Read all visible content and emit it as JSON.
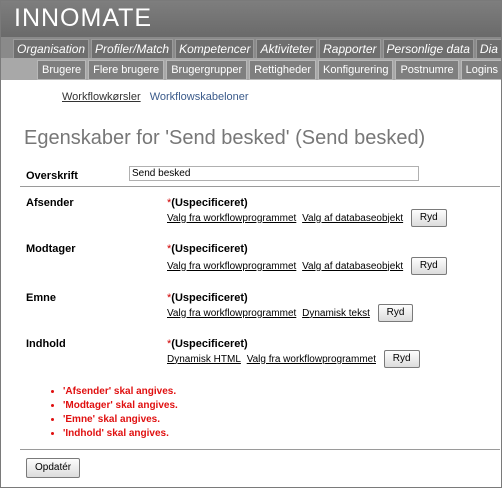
{
  "app": {
    "logo": "INNOMATE"
  },
  "main_tabs": [
    "Organisation",
    "Profiler/Match",
    "Kompetencer",
    "Aktiviteter",
    "Rapporter",
    "Personlige data",
    "Dia"
  ],
  "sub_tabs": [
    "Brugere",
    "Flere brugere",
    "Brugergrupper",
    "Rettigheder",
    "Konfigurering",
    "Postnumre",
    "Logins"
  ],
  "crumbs": {
    "active": "Workflowkørsler",
    "other": "Workflowskabeloner"
  },
  "page_title": "Egenskaber for 'Send besked' (Send besked)",
  "overskrift": {
    "label": "Overskrift",
    "value": "Send besked"
  },
  "unspecified_text": "(Uspecificeret)",
  "required_mark": "*",
  "fields": [
    {
      "label": "Afsender",
      "links": [
        "Valg fra workflowprogrammet",
        "Valg af databaseobjekt"
      ],
      "button": "Ryd"
    },
    {
      "label": "Modtager",
      "links": [
        "Valg fra workflowprogrammet",
        "Valg af databaseobjekt"
      ],
      "button": "Ryd"
    },
    {
      "label": "Emne",
      "links": [
        "Valg fra workflowprogrammet",
        "Dynamisk tekst"
      ],
      "button": "Ryd"
    },
    {
      "label": "Indhold",
      "links": [
        "Dynamisk HTML",
        "Valg fra workflowprogrammet"
      ],
      "button": "Ryd"
    }
  ],
  "errors": [
    "'Afsender' skal angives.",
    "'Modtager' skal angives.",
    "'Emne' skal angives.",
    "'Indhold' skal angives."
  ],
  "update_button": "Opdatér"
}
